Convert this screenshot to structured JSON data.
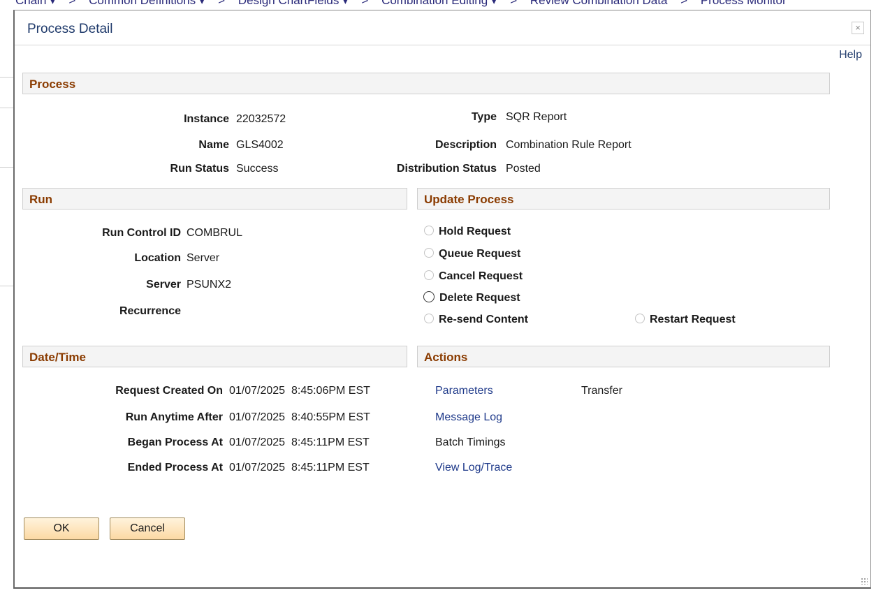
{
  "background_nav": [
    "Chain ▾",
    ">",
    "Common Definitions ▾",
    ">",
    "Design ChartFields ▾",
    ">",
    "Combination Editing ▾",
    ">",
    "Review Combination Data",
    ">",
    "Process Monitor"
  ],
  "modal": {
    "title": "Process Detail",
    "close_symbol": "×",
    "help_label": "Help"
  },
  "process": {
    "header": "Process",
    "instance_label": "Instance",
    "instance_value": "22032572",
    "name_label": "Name",
    "name_value": "GLS4002",
    "run_status_label": "Run Status",
    "run_status_value": "Success",
    "type_label": "Type",
    "type_value": "SQR Report",
    "description_label": "Description",
    "description_value": "Combination Rule Report",
    "distribution_status_label": "Distribution Status",
    "distribution_status_value": "Posted"
  },
  "run": {
    "header": "Run",
    "run_control_label": "Run Control ID",
    "run_control_value": "COMBRUL",
    "location_label": "Location",
    "location_value": "Server",
    "server_label": "Server",
    "server_value": "PSUNX2",
    "recurrence_label": "Recurrence",
    "recurrence_value": ""
  },
  "update_process": {
    "header": "Update Process",
    "options": [
      {
        "label": "Hold Request",
        "enabled": false
      },
      {
        "label": "Queue Request",
        "enabled": false
      },
      {
        "label": "Cancel Request",
        "enabled": false
      },
      {
        "label": "Delete Request",
        "enabled": true
      },
      {
        "label": "Re-send Content",
        "enabled": false
      },
      {
        "label": "Restart Request",
        "enabled": false
      }
    ]
  },
  "datetime": {
    "header": "Date/Time",
    "request_created_label": "Request Created On",
    "request_created_value": "01/07/2025  8:45:06PM EST",
    "run_anytime_label": "Run Anytime After",
    "run_anytime_value": "01/07/2025  8:40:55PM EST",
    "began_label": "Began Process At",
    "began_value": "01/07/2025  8:45:11PM EST",
    "ended_label": "Ended Process At",
    "ended_value": "01/07/2025  8:45:11PM EST"
  },
  "actions": {
    "header": "Actions",
    "parameters": "Parameters",
    "transfer": "Transfer",
    "message_log": "Message Log",
    "batch_timings": "Batch Timings",
    "view_log_trace": "View Log/Trace"
  },
  "buttons": {
    "ok": "OK",
    "cancel": "Cancel"
  },
  "colors": {
    "section_header_text": "#8a3b00",
    "link": "#1f3a8a",
    "title": "#1f3a6b",
    "button_fill": "#fcd9a4"
  }
}
